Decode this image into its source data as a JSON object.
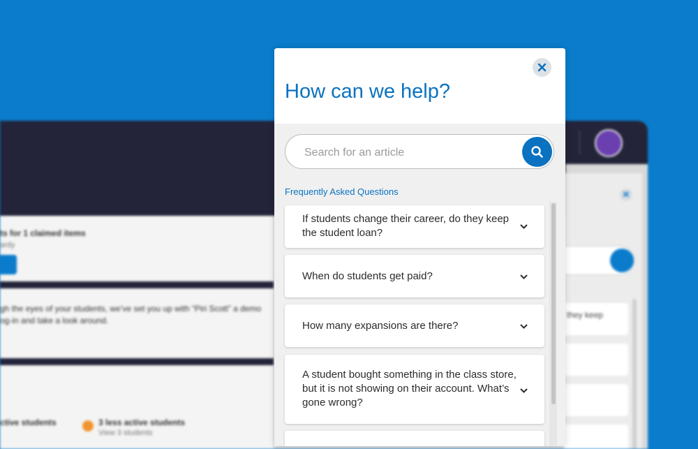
{
  "colors": {
    "backdrop": "#0a7ccb",
    "accent": "#0a72c0",
    "modal_bg": "#f0f0f0",
    "app_topbar": "#23243a",
    "check_green": "#3fa66a",
    "status_orange": "#f0942e"
  },
  "modal": {
    "close_icon": "close-icon",
    "title": "How can we help?",
    "search": {
      "placeholder": "Search for an article",
      "value": "",
      "button_icon": "search-icon"
    },
    "faq_heading": "Frequently Asked Questions",
    "faq_items": [
      {
        "question": "If students change their career, do they keep the student loan?",
        "icon": "chevron-down-icon"
      },
      {
        "question": "When do students get paid?",
        "icon": "chevron-down-icon"
      },
      {
        "question": "How many expansions are there?",
        "icon": "chevron-down-icon"
      },
      {
        "question": "A student bought something in the class store, but it is not showing on their account. What’s gone wrong?",
        "icon": "chevron-down-icon"
      }
    ]
  },
  "background_app": {
    "claimed_text": "ts for 1 claimed items",
    "claimed_sub": "ardy",
    "intro_line1": "gh the eyes of your students, we’ve set you up with “Piri Scott” a demo",
    "intro_line2": "og-in and take a look around.",
    "active_label": "ctive students",
    "less_active_label": "3 less active students",
    "less_active_link": "View 3 students",
    "panel_item_text": "they keep"
  }
}
